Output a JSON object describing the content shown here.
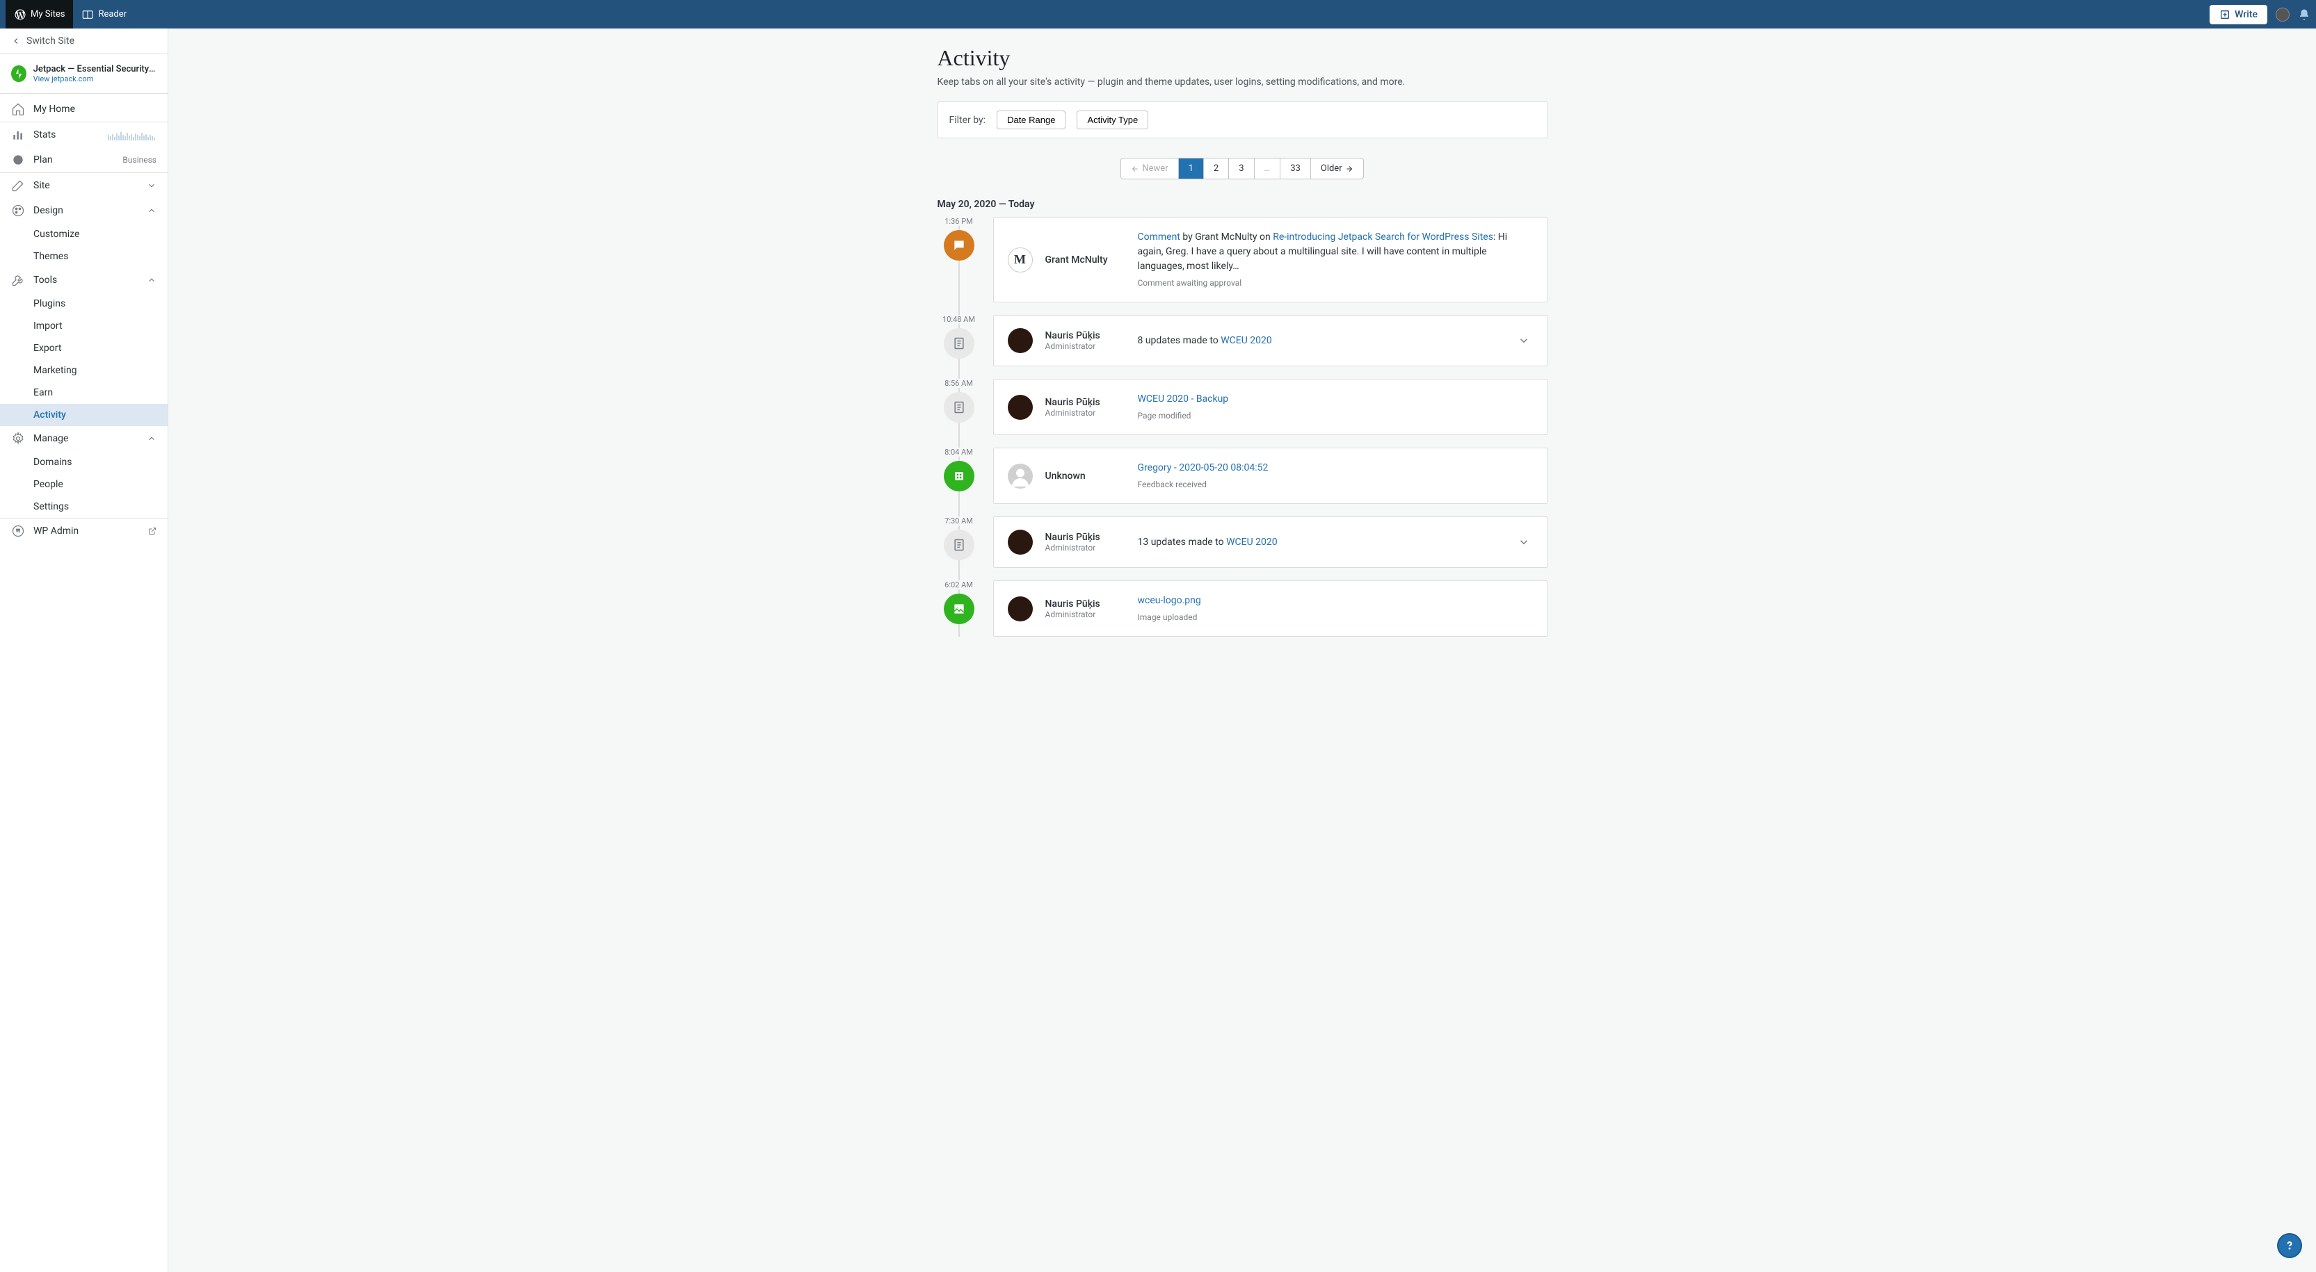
{
  "topbar": {
    "my_sites": "My Sites",
    "reader": "Reader",
    "write": "Write"
  },
  "sidebar": {
    "switch_site": "Switch Site",
    "site_name": "Jetpack — Essential Security & P…",
    "site_url": "View jetpack.com",
    "items": {
      "my_home": "My Home",
      "stats": "Stats",
      "plan": "Plan",
      "plan_badge": "Business",
      "site": "Site",
      "design": "Design",
      "customize": "Customize",
      "themes": "Themes",
      "tools": "Tools",
      "plugins": "Plugins",
      "import": "Import",
      "export": "Export",
      "marketing": "Marketing",
      "earn": "Earn",
      "activity": "Activity",
      "manage": "Manage",
      "domains": "Domains",
      "people": "People",
      "settings": "Settings",
      "wp_admin": "WP Admin"
    }
  },
  "page": {
    "title": "Activity",
    "subtitle": "Keep tabs on all your site's activity — plugin and theme updates, user logins, setting modifications, and more.",
    "filter_by": "Filter by:",
    "filter_date": "Date Range",
    "filter_type": "Activity Type"
  },
  "pagination": {
    "newer": "Newer",
    "p1": "1",
    "p2": "2",
    "p3": "3",
    "ellipsis": "…",
    "last": "33",
    "older": "Older"
  },
  "date_header": "May 20, 2020 — Today",
  "activities": [
    {
      "time": "1:36 PM",
      "badge": "orange",
      "actor": "Grant McNulty",
      "role": "",
      "prefix": "Comment",
      "mid": " by Grant McNulty on ",
      "link": "Re-introducing Jetpack Search for WordPress Sites",
      "suffix": ": Hi again, Greg. I have a query about a multilingual site. I will have content in multiple languages, most likely…",
      "meta": "Comment awaiting approval",
      "avatar_bg": "#fff",
      "avatar_letter": "M",
      "expandable": false
    },
    {
      "time": "10:48 AM",
      "badge": "gray",
      "actor": "Nauris Pūķis",
      "role": "Administrator",
      "plain": "8 updates made to ",
      "link": "WCEU 2020",
      "avatar_bg": "#2a1810",
      "expandable": true
    },
    {
      "time": "8:56 AM",
      "badge": "gray",
      "actor": "Nauris Pūķis",
      "role": "Administrator",
      "link": "WCEU 2020 - Backup",
      "meta": "Page modified",
      "avatar_bg": "#2a1810",
      "expandable": false
    },
    {
      "time": "8:04 AM",
      "badge": "green",
      "badge_icon": "form",
      "actor": "Unknown",
      "role": "",
      "link": "Gregory - 2020-05-20 08:04:52",
      "meta": "Feedback received",
      "avatar_bg": "#d0d0d0",
      "avatar_unknown": true,
      "expandable": false
    },
    {
      "time": "7:30 AM",
      "badge": "gray",
      "actor": "Nauris Pūķis",
      "role": "Administrator",
      "plain": "13 updates made to ",
      "link": "WCEU 2020",
      "avatar_bg": "#2a1810",
      "expandable": true
    },
    {
      "time": "6:02 AM",
      "badge": "green",
      "badge_icon": "image",
      "actor": "Nauris Pūķis",
      "role": "Administrator",
      "link": "wceu-logo.png",
      "meta": "Image uploaded",
      "avatar_bg": "#2a1810",
      "expandable": false
    }
  ]
}
